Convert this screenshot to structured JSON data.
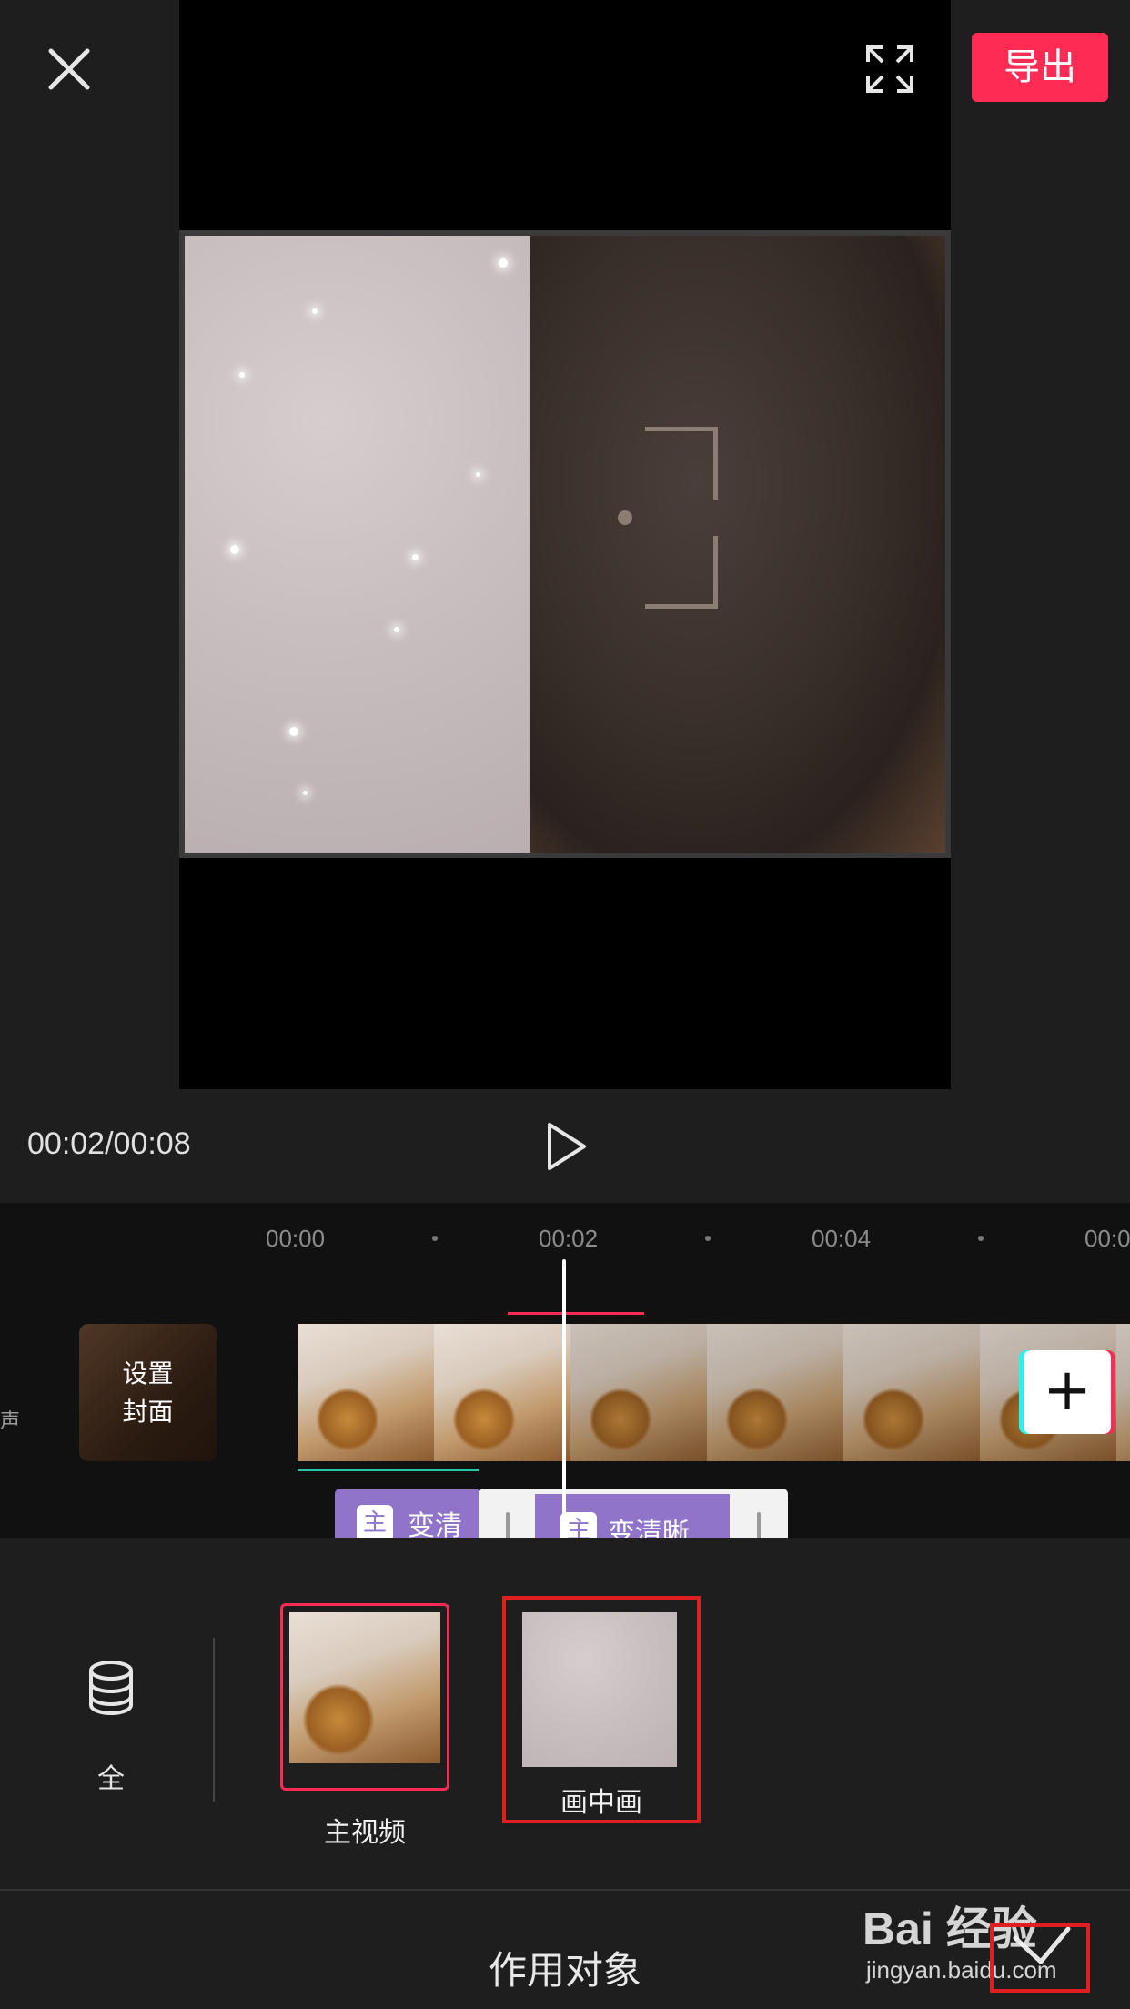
{
  "header": {
    "export_label": "导出",
    "close_icon": "close-icon",
    "fullscreen_icon": "fullscreen-icon"
  },
  "playback": {
    "timecode": "00:02/00:08",
    "play_icon": "play-icon"
  },
  "timeline": {
    "ticks": [
      "00:00",
      "00:02",
      "00:04",
      "00:0"
    ],
    "audio_label": "声",
    "cover_label": "设置\n封面",
    "add_clip_icon": "plus-icon",
    "sub_clips": [
      {
        "tag": "主",
        "text": "变清晰"
      },
      {
        "tag": "主",
        "text": "变清晰"
      }
    ]
  },
  "panel": {
    "all_label": "全",
    "all_icon": "layers-icon",
    "targets": [
      {
        "label": "主视频"
      },
      {
        "label": "画中画"
      }
    ],
    "title": "作用对象",
    "confirm_icon": "check-icon"
  },
  "watermark": {
    "text": "Bai 经验",
    "url": "jingyan.baidu.com"
  },
  "colors": {
    "accent": "#fe2c55",
    "annotation_red": "#e02020",
    "clip_purple": "#8f74c9"
  }
}
